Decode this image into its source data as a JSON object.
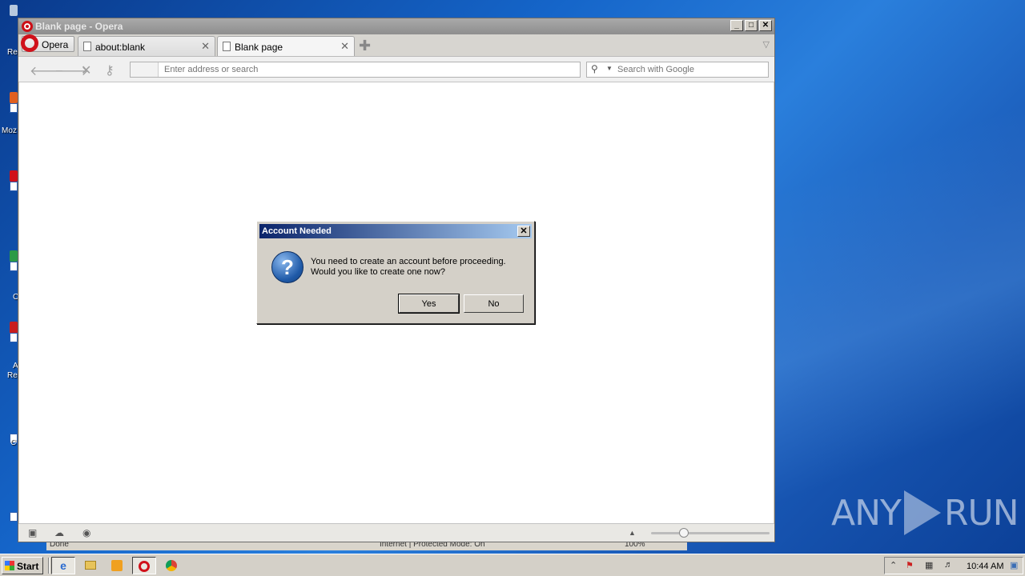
{
  "desktop": {
    "watermark": "ANY RUN",
    "icon_labels": [
      "Re",
      "Moz",
      "",
      "C",
      "A",
      "Re",
      "C"
    ],
    "background_color": "#1565c9"
  },
  "ghost_statusbar": {
    "done": "Done",
    "zone": "Internet | Protected Mode: On",
    "zoom": "100%"
  },
  "window": {
    "title": "Blank page - Opera",
    "controls": {
      "minimize": "_",
      "maximize": "□",
      "close": "✕"
    },
    "opera_menu_label": "Opera",
    "tabs": [
      {
        "label": "about:blank",
        "close": "✕",
        "active": false
      },
      {
        "label": "Blank page",
        "close": "✕",
        "active": true
      }
    ],
    "new_tab": "✚",
    "tab_menu": "▽"
  },
  "toolbar": {
    "back": "🡐",
    "forward": "🡒",
    "stop": "✕",
    "key": "⚷",
    "address_placeholder": "Enter address or search",
    "address_value": "",
    "search_placeholder": "Search with Google",
    "search_icon": "search-icon",
    "search_dropdown": "▼"
  },
  "statusbar": {
    "panel_icon": "▣",
    "cloud_icon": "☁",
    "speed_icon": "◉",
    "arrow_up": "▲",
    "zoom_level": 0.28
  },
  "dialog": {
    "title": "Account Needed",
    "close": "✕",
    "icon": "?",
    "message_line1": "You need to create an account before proceeding.",
    "message_line2": "Would you like to create one now?",
    "yes": "Yes",
    "no": "No"
  },
  "taskbar": {
    "start": "Start",
    "apps": [
      "ie-icon",
      "folder-icon",
      "media-icon",
      "opera-icon",
      "chrome-icon"
    ],
    "tray_chevron": "⌃",
    "time": "10:44 AM"
  }
}
